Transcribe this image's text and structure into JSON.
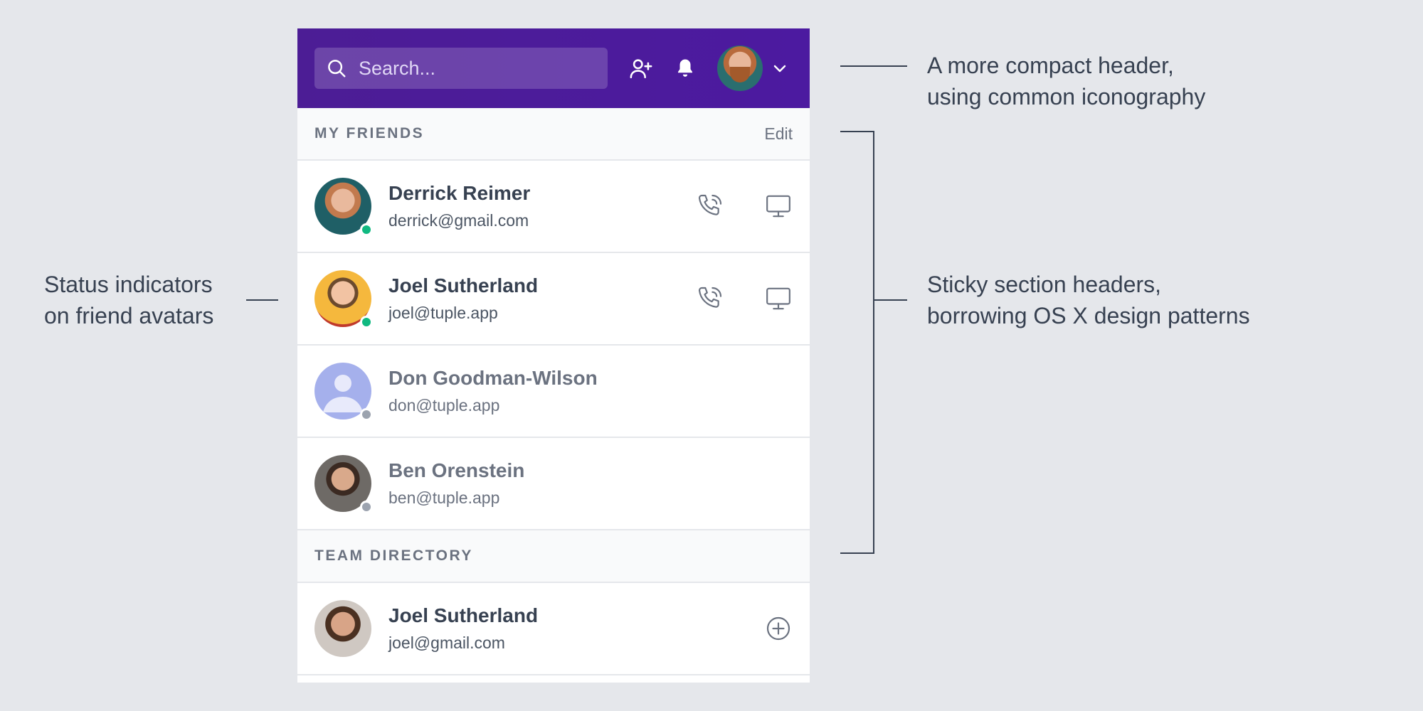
{
  "header": {
    "search_placeholder": "Search...",
    "icons": [
      "search-icon",
      "add-user-icon",
      "bell-icon",
      "chevron-down-icon"
    ],
    "brand_color": "#4c1d95"
  },
  "sections": [
    {
      "title": "MY FRIENDS",
      "action_label": "Edit",
      "items": [
        {
          "name": "Derrick Reimer",
          "email": "derrick@gmail.com",
          "status": "online"
        },
        {
          "name": "Joel Sutherland",
          "email": "joel@tuple.app",
          "status": "online"
        },
        {
          "name": "Don Goodman-Wilson",
          "email": "don@tuple.app",
          "status": "offline"
        },
        {
          "name": "Ben Orenstein",
          "email": "ben@tuple.app",
          "status": "offline"
        }
      ]
    },
    {
      "title": "TEAM DIRECTORY",
      "items": [
        {
          "name": "Joel Sutherland",
          "email": "joel@gmail.com"
        }
      ]
    }
  ],
  "annotations": {
    "header_note": [
      "A more compact header,",
      "using common iconography"
    ],
    "status_note": [
      "Status indicators",
      "on friend avatars"
    ],
    "sticky_note": [
      "Sticky section headers,",
      "borrowing OS X design patterns"
    ]
  },
  "colors": {
    "online": "#10b981",
    "offline": "#9ca3af"
  }
}
